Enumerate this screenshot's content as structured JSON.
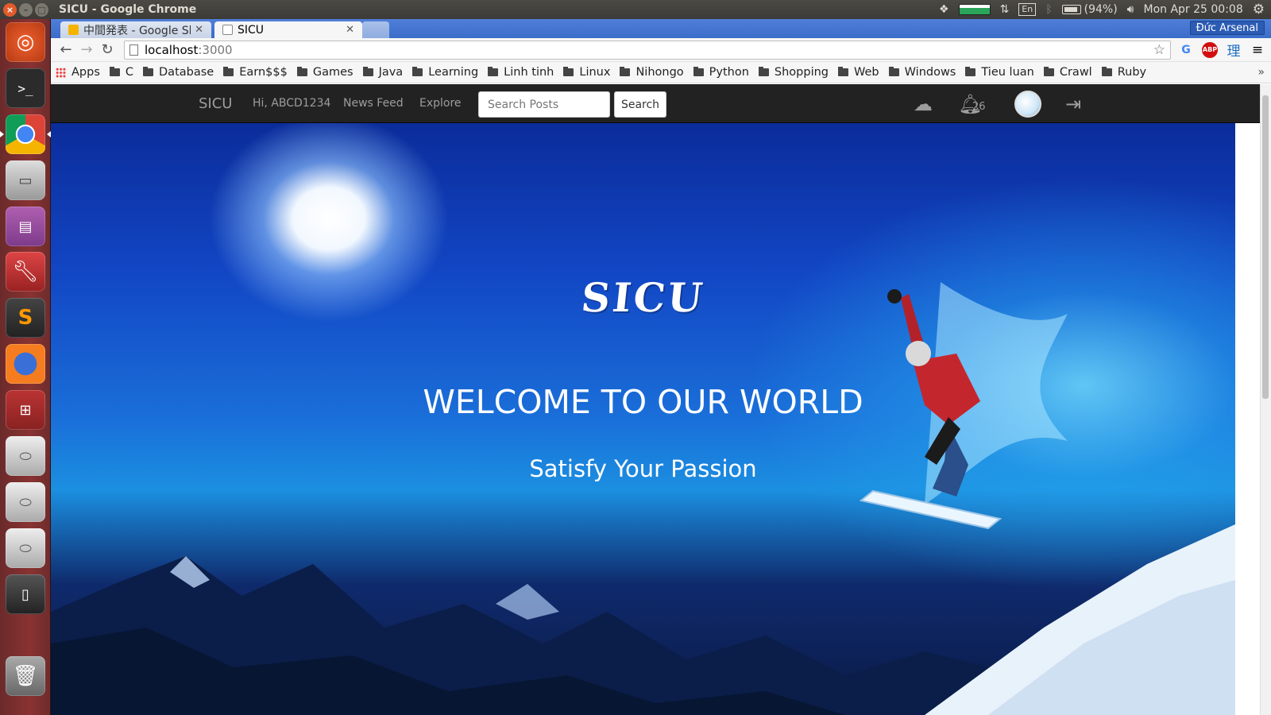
{
  "system": {
    "window_title": "SICU - Google Chrome",
    "battery": "(94%)",
    "datetime": "Mon Apr 25 00:08",
    "keyboard": "En"
  },
  "browser": {
    "tabs": [
      {
        "label": "中間発表 - Google Sl"
      },
      {
        "label": "SICU"
      }
    ],
    "profile": "Đức Arsenal",
    "url_host": "localhost",
    "url_port": ":3000",
    "bookmarks": [
      "Apps",
      "C",
      "Database",
      "Earn$$$",
      "Games",
      "Java",
      "Learning",
      "Linh tinh",
      "Linux",
      "Nihongo",
      "Python",
      "Shopping",
      "Web",
      "Windows",
      "Tieu luan",
      "Crawl",
      "Ruby"
    ],
    "more": "»"
  },
  "navbar": {
    "brand": "SICU",
    "greeting": "Hi, ABCD1234",
    "news_feed": "News Feed",
    "explore": "Explore",
    "search_placeholder": "Search Posts",
    "search_button": "Search",
    "notification_count": "26"
  },
  "hero": {
    "logo": "SICU",
    "headline": "WELCOME TO OUR WORLD",
    "tagline": "Satisfy Your Passion"
  },
  "colors": {
    "launcher": "#8a3232",
    "chrome_tabstrip": "#3b6cc9",
    "navbar": "#222222"
  }
}
